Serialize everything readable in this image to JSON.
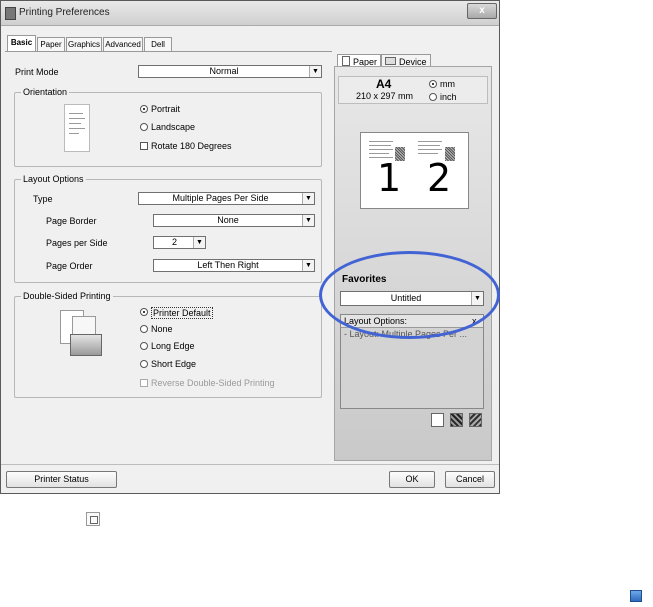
{
  "window": {
    "title": "Printing Preferences",
    "close_label": "x"
  },
  "tabs": [
    {
      "label": "Basic"
    },
    {
      "label": "Paper"
    },
    {
      "label": "Graphics"
    },
    {
      "label": "Advanced"
    },
    {
      "label": "Dell"
    }
  ],
  "print_mode": {
    "label": "Print Mode",
    "value": "Normal"
  },
  "orientation": {
    "title": "Orientation",
    "options": [
      "Portrait",
      "Landscape"
    ],
    "selected": "Portrait",
    "rotate_label": "Rotate 180 Degrees"
  },
  "layout": {
    "title": "Layout Options",
    "type_label": "Type",
    "type_value": "Multiple Pages Per Side",
    "border_label": "Page Border",
    "border_value": "None",
    "pps_label": "Pages per Side",
    "pps_value": "2",
    "order_label": "Page Order",
    "order_value": "Left Then Right"
  },
  "duplex": {
    "title": "Double-Sided Printing",
    "options": [
      "Printer Default",
      "None",
      "Long Edge",
      "Short Edge"
    ],
    "selected": "Printer Default",
    "reverse_label": "Reverse Double-Sided Printing"
  },
  "right_panel": {
    "tab_paper": "Paper",
    "tab_device": "Device",
    "paper_size": "A4",
    "paper_dims": "210 x 297 mm",
    "unit_mm": "mm",
    "unit_inch": "inch",
    "preview_pages": [
      "1",
      "2"
    ],
    "favorites_label": "Favorites",
    "favorites_value": "Untitled",
    "summary_title": "Layout Options:",
    "summary_close": "x",
    "summary_line": "- Layout: Multiple Pages Per ..."
  },
  "footer": {
    "status_button": "Printer Status",
    "ok_button": "OK",
    "cancel_button": "Cancel"
  },
  "colors": {
    "highlight_ring": "#4263d4"
  }
}
